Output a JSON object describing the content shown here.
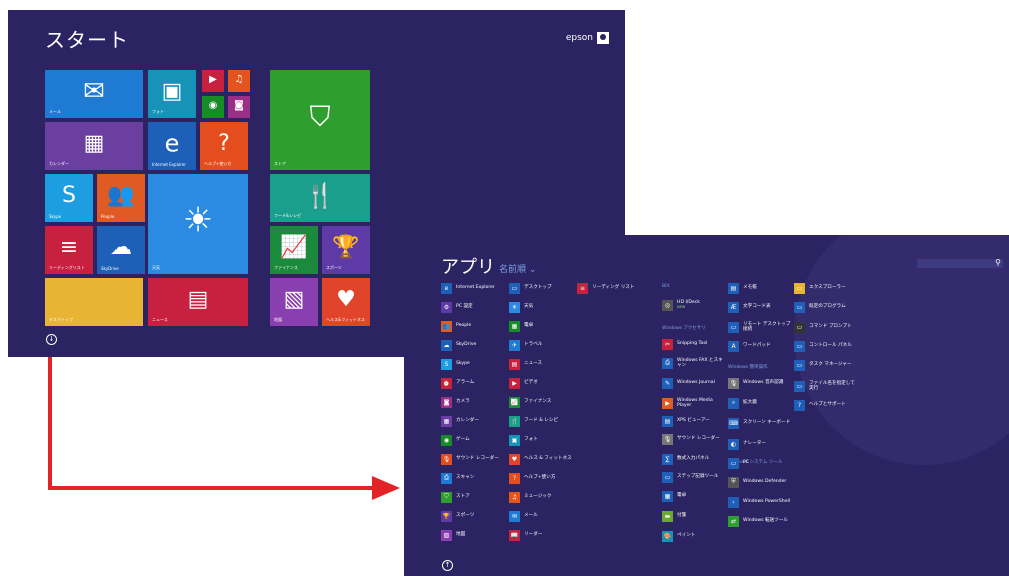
{
  "start": {
    "title": "スタート",
    "user": "epson",
    "tiles": [
      {
        "name": "mail",
        "label": "メール",
        "icon": "✉",
        "color": "#1e7ad3"
      },
      {
        "name": "photos",
        "label": "フォト",
        "icon": "▣",
        "color": "#1893b8"
      },
      {
        "name": "video",
        "label": "",
        "icon": "▶",
        "color": "#c8213f"
      },
      {
        "name": "music",
        "label": "",
        "icon": "♫",
        "color": "#e4541d"
      },
      {
        "name": "games",
        "label": "",
        "icon": "◉",
        "color": "#178b26"
      },
      {
        "name": "camera",
        "label": "",
        "icon": "◙",
        "color": "#9b2f87"
      },
      {
        "name": "calendar",
        "label": "カレンダー",
        "icon": "▦",
        "color": "#6b3fa0"
      },
      {
        "name": "ie",
        "label": "Internet Explorer",
        "icon": "e",
        "color": "#1e60b8"
      },
      {
        "name": "help",
        "label": "ヘルプ+使い方",
        "icon": "?",
        "color": "#e44d1d"
      },
      {
        "name": "skype",
        "label": "Skype",
        "icon": "S",
        "color": "#1d9de2"
      },
      {
        "name": "people",
        "label": "People",
        "icon": "👥",
        "color": "#e05a23"
      },
      {
        "name": "weather",
        "label": "天気",
        "icon": "☀",
        "color": "#2b8be2"
      },
      {
        "name": "reading",
        "label": "リーディングリスト",
        "icon": "≡",
        "color": "#c8213f"
      },
      {
        "name": "skydrive",
        "label": "SkyDrive",
        "icon": "☁",
        "color": "#1e60b8"
      },
      {
        "name": "desktop",
        "label": "デスクトップ",
        "icon": "",
        "color": "#e7b533"
      },
      {
        "name": "news",
        "label": "ニュース",
        "icon": "▤",
        "color": "#c8213f"
      },
      {
        "name": "store",
        "label": "ストア",
        "icon": "⛉",
        "color": "#2e9f2e"
      },
      {
        "name": "food",
        "label": "フード&レシピ",
        "icon": "🍴",
        "color": "#1a9f8d"
      },
      {
        "name": "finance",
        "label": "ファイナンス",
        "icon": "📈",
        "color": "#1b8a3c"
      },
      {
        "name": "sports",
        "label": "スポーツ",
        "icon": "🏆",
        "color": "#5e3aa6"
      },
      {
        "name": "maps",
        "label": "地図",
        "icon": "▧",
        "color": "#8a3fb0"
      },
      {
        "name": "health",
        "label": "ヘルス&フィットネス",
        "icon": "♥",
        "color": "#e0452b"
      }
    ]
  },
  "apps": {
    "title": "アプリ",
    "sort": "名前順 ⌄",
    "search_icon": "⚲",
    "groups": [
      {
        "label": "Bilt"
      },
      {
        "label": "Windows アクセサリ"
      },
      {
        "label": "Windows 簡単操作"
      },
      {
        "label": "Windows システム ツール"
      }
    ],
    "items": [
      {
        "label": "Internet Explorer",
        "color": "#1e60b8",
        "icon": "e"
      },
      {
        "label": "PC 設定",
        "color": "#5e3aa6",
        "icon": "⚙"
      },
      {
        "label": "People",
        "color": "#e05a23",
        "icon": "👥"
      },
      {
        "label": "SkyDrive",
        "color": "#1e60b8",
        "icon": "☁"
      },
      {
        "label": "Skype",
        "color": "#1d9de2",
        "icon": "S"
      },
      {
        "label": "アラーム",
        "color": "#c8213f",
        "icon": "⏰"
      },
      {
        "label": "カメラ",
        "color": "#9b2f87",
        "icon": "◙"
      },
      {
        "label": "カレンダー",
        "color": "#6b3fa0",
        "icon": "▦"
      },
      {
        "label": "ゲーム",
        "color": "#178b26",
        "icon": "◉"
      },
      {
        "label": "サウンド レコーダー",
        "color": "#e44d1d",
        "icon": "🎙"
      },
      {
        "label": "スキャン",
        "color": "#1e7ad3",
        "icon": "⎙"
      },
      {
        "label": "ストア",
        "color": "#2e9f2e",
        "icon": "⛉"
      },
      {
        "label": "スポーツ",
        "color": "#5e3aa6",
        "icon": "🏆"
      },
      {
        "label": "地図",
        "color": "#8a3fb0",
        "icon": "▧"
      },
      {
        "label": "デスクトップ",
        "color": "#1e60b8",
        "icon": "▭"
      },
      {
        "label": "天気",
        "color": "#2b8be2",
        "icon": "☀"
      },
      {
        "label": "電卓",
        "color": "#178b26",
        "icon": "▦"
      },
      {
        "label": "トラベル",
        "color": "#1e7ad3",
        "icon": "✈"
      },
      {
        "label": "ニュース",
        "color": "#c8213f",
        "icon": "▤"
      },
      {
        "label": "ビデオ",
        "color": "#c8213f",
        "icon": "▶"
      },
      {
        "label": "ファイナンス",
        "color": "#1b8a3c",
        "icon": "📈"
      },
      {
        "label": "フード & レシピ",
        "color": "#1a9f8d",
        "icon": "🍴"
      },
      {
        "label": "フォト",
        "color": "#1893b8",
        "icon": "▣"
      },
      {
        "label": "ヘルス & フィットネス",
        "color": "#e0452b",
        "icon": "♥"
      },
      {
        "label": "ヘルプ+使い方",
        "color": "#e44d1d",
        "icon": "?"
      },
      {
        "label": "ミュージック",
        "color": "#e4541d",
        "icon": "♫"
      },
      {
        "label": "メール",
        "color": "#1e7ad3",
        "icon": "✉"
      },
      {
        "label": "リーダー",
        "color": "#c8213f",
        "icon": "📖"
      },
      {
        "label": "リーディング リスト",
        "color": "#c8213f",
        "icon": "≡"
      },
      {
        "label": "HD I/Deck",
        "color": "#555555",
        "icon": "◎",
        "badge": "NEW"
      },
      {
        "label": "Snipping Tool",
        "color": "#c8213f",
        "icon": "✂"
      },
      {
        "label": "Windows FAX とスキャン",
        "color": "#1e60b8",
        "icon": "⎙"
      },
      {
        "label": "Windows Journal",
        "color": "#1e60b8",
        "icon": "✎"
      },
      {
        "label": "Windows Media Player",
        "color": "#e05a23",
        "icon": "▶"
      },
      {
        "label": "XPS ビューアー",
        "color": "#1e60b8",
        "icon": "▤"
      },
      {
        "label": "サウンド レコーダー",
        "color": "#777777",
        "icon": "🎙"
      },
      {
        "label": "数式入力パネル",
        "color": "#1e60b8",
        "icon": "∑"
      },
      {
        "label": "ステップ記録ツール",
        "color": "#1e60b8",
        "icon": "▭"
      },
      {
        "label": "電卓",
        "color": "#1e60b8",
        "icon": "▦"
      },
      {
        "label": "付箋",
        "color": "#6aab2e",
        "icon": "▬"
      },
      {
        "label": "ペイント",
        "color": "#1893b8",
        "icon": "🎨"
      },
      {
        "label": "メモ帳",
        "color": "#1e60b8",
        "icon": "▤"
      },
      {
        "label": "文字コード表",
        "color": "#1e60b8",
        "icon": "Æ"
      },
      {
        "label": "リモート デスクトップ接続",
        "color": "#1e60b8",
        "icon": "▭"
      },
      {
        "label": "ワードパッド",
        "color": "#1e60b8",
        "icon": "A"
      },
      {
        "label": "Windows 音声認識",
        "color": "#777777",
        "icon": "🎙"
      },
      {
        "label": "拡大鏡",
        "color": "#1e60b8",
        "icon": "⌕"
      },
      {
        "label": "スクリーン キーボード",
        "color": "#1e60b8",
        "icon": "⌨"
      },
      {
        "label": "ナレーター",
        "color": "#1e60b8",
        "icon": "◐"
      },
      {
        "label": "PC",
        "color": "#1e60b8",
        "icon": "▭"
      },
      {
        "label": "Windows Defender",
        "color": "#555555",
        "icon": "⛨"
      },
      {
        "label": "Windows PowerShell",
        "color": "#1e60b8",
        "icon": "›"
      },
      {
        "label": "Windows 転送ツール",
        "color": "#2e9f2e",
        "icon": "⇄"
      },
      {
        "label": "エクスプローラー",
        "color": "#e7b533",
        "icon": "▭"
      },
      {
        "label": "既定のプログラム",
        "color": "#1e60b8",
        "icon": "▭"
      },
      {
        "label": "コマンド プロンプト",
        "color": "#333333",
        "icon": "▭"
      },
      {
        "label": "コントロール パネル",
        "color": "#1e60b8",
        "icon": "▭"
      },
      {
        "label": "タスク マネージャー",
        "color": "#1e60b8",
        "icon": "▭"
      },
      {
        "label": "ファイル名を指定して実行",
        "color": "#1e60b8",
        "icon": "▭"
      },
      {
        "label": "ヘルプとサポート",
        "color": "#1e60b8",
        "icon": "?"
      }
    ]
  }
}
